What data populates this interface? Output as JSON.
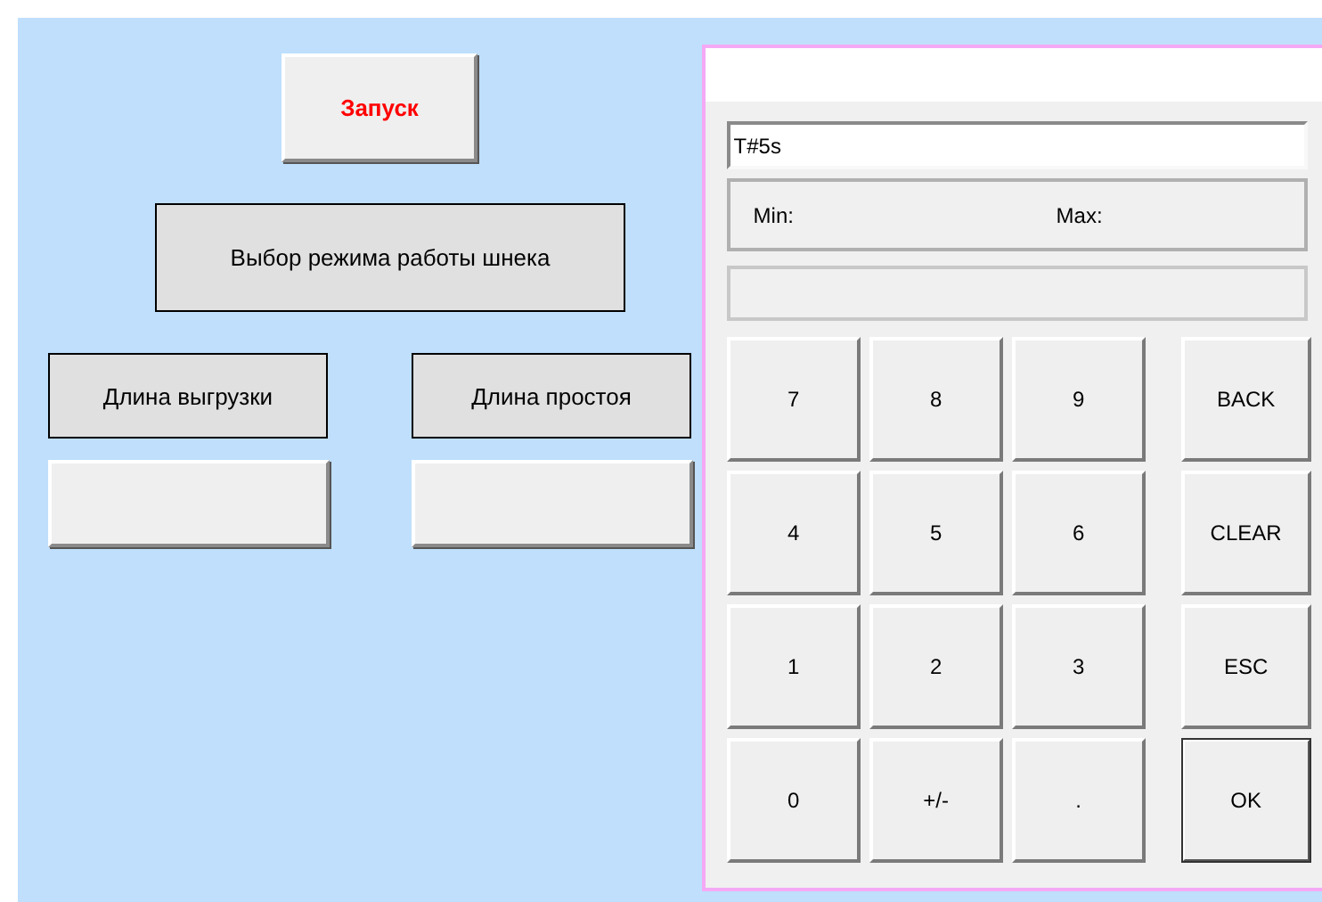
{
  "start_button": {
    "label": "Запуск"
  },
  "mode_button": {
    "label": "Выбор режима работы шнека"
  },
  "length_fields": [
    {
      "label": "Длина выгрузки"
    },
    {
      "label": "Длина простоя"
    }
  ],
  "keypad": {
    "input": "T#5s",
    "min_label": "Min:",
    "max_label": "Max:",
    "rows": [
      [
        {
          "label": "7",
          "default": false
        },
        {
          "label": "8",
          "default": false
        },
        {
          "label": "9",
          "default": false
        },
        {
          "label": "BACK",
          "default": false
        }
      ],
      [
        {
          "label": "4",
          "default": false
        },
        {
          "label": "5",
          "default": false
        },
        {
          "label": "6",
          "default": false
        },
        {
          "label": "CLEAR",
          "default": false
        }
      ],
      [
        {
          "label": "1",
          "default": false
        },
        {
          "label": "2",
          "default": false
        },
        {
          "label": "3",
          "default": false
        },
        {
          "label": "ESC",
          "default": false
        }
      ],
      [
        {
          "label": "0",
          "default": false
        },
        {
          "label": "+/-",
          "default": false
        },
        {
          "label": ".",
          "default": false
        },
        {
          "label": "OK",
          "default": true
        }
      ]
    ]
  }
}
